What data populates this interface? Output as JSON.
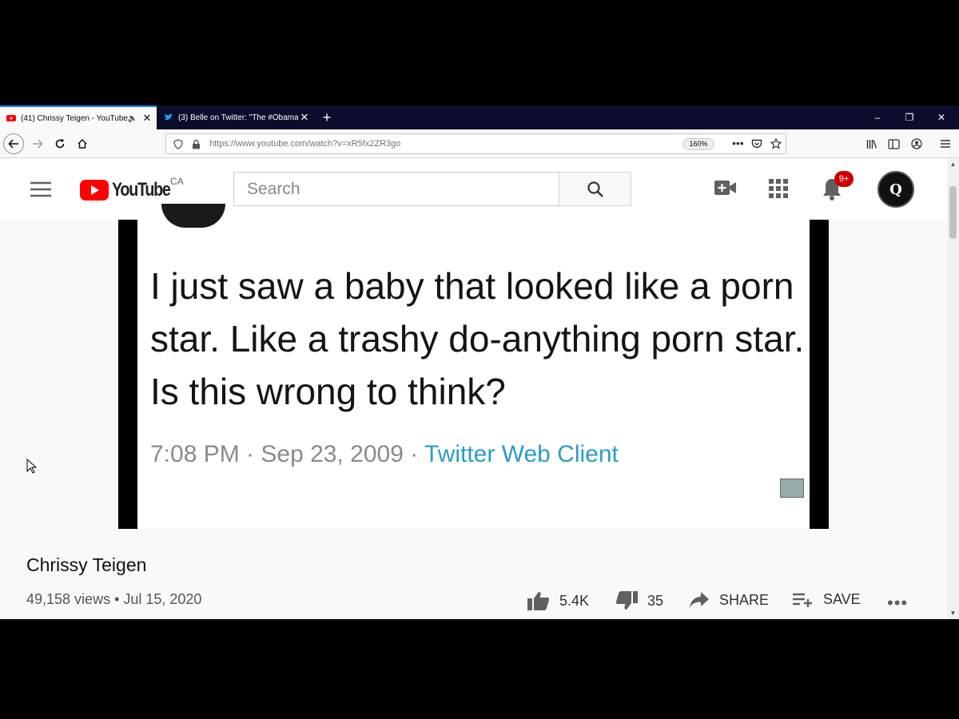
{
  "browser": {
    "tabs": [
      {
        "title": "(41) Chrissy Teigen - YouTube",
        "icon": "youtube-icon",
        "active": true
      },
      {
        "title": "(3) Belle on Twitter: \"The #Obama",
        "icon": "twitter-icon",
        "active": false
      }
    ],
    "url": "https://www.youtube.com/watch?v=xR5fx2ZR3go",
    "zoom": "160%"
  },
  "youtube": {
    "logo_text": "YouTube",
    "country": "CA",
    "search_placeholder": "Search",
    "notification_count": "9+",
    "brand_color": "#ff0000"
  },
  "tweet": {
    "text": "I just saw a baby that looked like a porn star. Like a trashy do-anything porn star. Is this wrong to think?",
    "time": "7:08 PM · Sep 23, 2009 · ",
    "source": "Twitter Web Client"
  },
  "video": {
    "title": "Chrissy Teigen",
    "views_date": "49,158 views • Jul 15, 2020",
    "likes": "5.4K",
    "dislikes": "35",
    "share_label": "SHARE",
    "save_label": "SAVE"
  }
}
